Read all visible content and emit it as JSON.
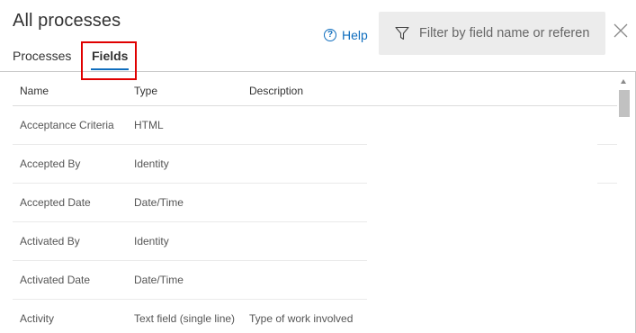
{
  "header": {
    "title": "All processes",
    "help_label": "Help"
  },
  "filter": {
    "placeholder": "Filter by field name or referen"
  },
  "tabs": [
    {
      "label": "Processes"
    },
    {
      "label": "Fields"
    }
  ],
  "table": {
    "columns": [
      "Name",
      "Type",
      "Description"
    ],
    "rows": [
      {
        "name": "Acceptance Criteria",
        "type": "HTML",
        "description": ""
      },
      {
        "name": "Accepted By",
        "type": "Identity",
        "description": ""
      },
      {
        "name": "Accepted Date",
        "type": "Date/Time",
        "description": ""
      },
      {
        "name": "Activated By",
        "type": "Identity",
        "description": ""
      },
      {
        "name": "Activated Date",
        "type": "Date/Time",
        "description": ""
      },
      {
        "name": "Activity",
        "type": "Text field (single line)",
        "description": "Type of work involved"
      }
    ]
  },
  "colors": {
    "accent": "#106ebe",
    "highlight": "#e00000",
    "filter_bg": "#ececec"
  },
  "icons": {
    "help": "question-circle-icon",
    "filter": "funnel-icon",
    "close": "close-icon"
  }
}
